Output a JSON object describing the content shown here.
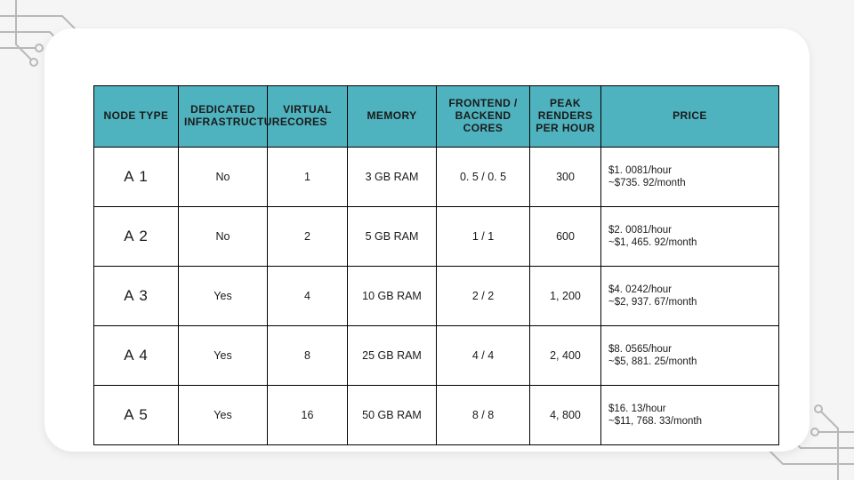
{
  "table": {
    "headers": {
      "node_type": "NODE TYPE",
      "dedicated": "DEDICATED INFRASTRUCTURE",
      "vcores": "VIRTUAL CORES",
      "memory": "MEMORY",
      "febe": "FRONTEND / BACKEND CORES",
      "peak": "PEAK RENDERS PER HOUR",
      "price": "PRICE"
    },
    "rows": [
      {
        "node_type": "A 1",
        "dedicated": "No",
        "vcores": "1",
        "memory": "3 GB RAM",
        "febe": "0. 5 / 0. 5",
        "peak": "300",
        "price": "$1. 0081/hour\n~$735. 92/month"
      },
      {
        "node_type": "A 2",
        "dedicated": "No",
        "vcores": "2",
        "memory": "5 GB RAM",
        "febe": "1 / 1",
        "peak": "600",
        "price": "$2. 0081/hour\n~$1, 465. 92/month"
      },
      {
        "node_type": "A 3",
        "dedicated": "Yes",
        "vcores": "4",
        "memory": "10 GB RAM",
        "febe": "2 / 2",
        "peak": "1, 200",
        "price": "$4. 0242/hour\n~$2, 937. 67/month"
      },
      {
        "node_type": "A 4",
        "dedicated": "Yes",
        "vcores": "8",
        "memory": "25 GB RAM",
        "febe": "4 / 4",
        "peak": "2, 400",
        "price": "$8. 0565/hour\n~$5, 881. 25/month"
      },
      {
        "node_type": "A 5",
        "dedicated": "Yes",
        "vcores": "16",
        "memory": "50 GB RAM",
        "febe": "8 / 8",
        "peak": "4, 800",
        "price": "$16. 13/hour\n~$11, 768. 33/month"
      }
    ]
  },
  "chart_data": {
    "type": "table",
    "columns": [
      "NODE TYPE",
      "DEDICATED INFRASTRUCTURE",
      "VIRTUAL CORES",
      "MEMORY",
      "FRONTEND / BACKEND CORES",
      "PEAK RENDERS PER HOUR",
      "PRICE"
    ],
    "rows": [
      [
        "A 1",
        "No",
        "1",
        "3 GB RAM",
        "0. 5 / 0. 5",
        "300",
        "$1. 0081/hour ~$735. 92/month"
      ],
      [
        "A 2",
        "No",
        "2",
        "5 GB RAM",
        "1 / 1",
        "600",
        "$2. 0081/hour ~$1, 465. 92/month"
      ],
      [
        "A 3",
        "Yes",
        "4",
        "10 GB RAM",
        "2 / 2",
        "1, 200",
        "$4. 0242/hour ~$2, 937. 67/month"
      ],
      [
        "A 4",
        "Yes",
        "8",
        "25 GB RAM",
        "4 / 4",
        "2, 400",
        "$8. 0565/hour ~$5, 881. 25/month"
      ],
      [
        "A 5",
        "Yes",
        "16",
        "50 GB RAM",
        "8 / 8",
        "4, 800",
        "$16. 13/hour ~$11, 768. 33/month"
      ]
    ]
  }
}
